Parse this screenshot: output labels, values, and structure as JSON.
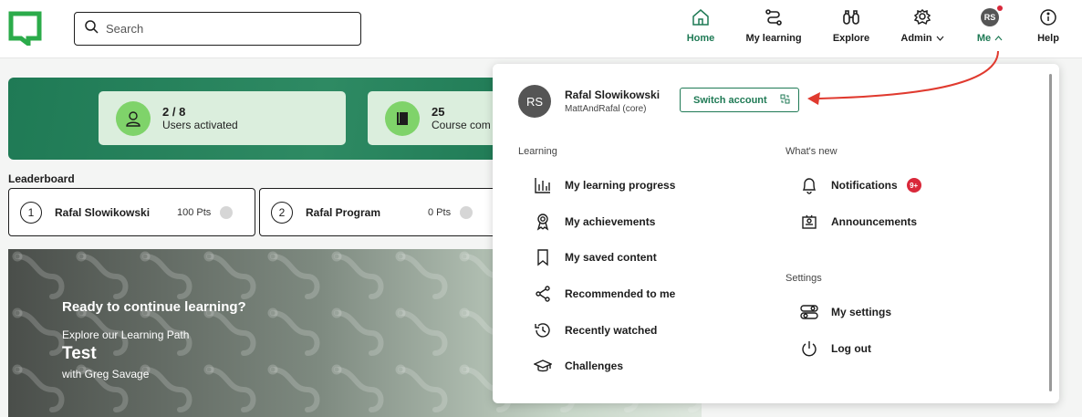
{
  "nav": {
    "search_placeholder": "Search",
    "items": [
      {
        "label": "Home",
        "icon": "home-icon"
      },
      {
        "label": "My learning",
        "icon": "learning-path-icon"
      },
      {
        "label": "Explore",
        "icon": "binoculars-icon"
      },
      {
        "label": "Admin",
        "icon": "admin-gear-icon"
      },
      {
        "label": "Me",
        "icon": "avatar"
      },
      {
        "label": "Help",
        "icon": "info-icon"
      }
    ],
    "avatar_initials": "RS",
    "accent_color": "#1f7a55"
  },
  "stats": [
    {
      "value": "2 / 8",
      "label": "Users activated",
      "icon": "user-icon"
    },
    {
      "value": "25",
      "label": "Course com",
      "icon": "book-icon"
    }
  ],
  "leaderboard": {
    "title": "Leaderboard",
    "entries": [
      {
        "rank": "1",
        "name": "Rafal Slowikowski",
        "points": "100 Pts"
      },
      {
        "rank": "2",
        "name": "Rafal Program",
        "points": "0 Pts"
      }
    ]
  },
  "hero": {
    "heading": "Ready to continue learning?",
    "subheading": "Explore our Learning Path",
    "path_title": "Test",
    "author": "with Greg Savage"
  },
  "menu": {
    "user_initials": "RS",
    "user_name": "Rafal Slowikowski",
    "user_org": "MattAndRafal (core)",
    "switch_label": "Switch account",
    "learning_title": "Learning",
    "learning_items": [
      {
        "label": "My learning progress",
        "icon": "bar-chart-icon"
      },
      {
        "label": "My achievements",
        "icon": "award-icon"
      },
      {
        "label": "My saved content",
        "icon": "bookmark-icon"
      },
      {
        "label": "Recommended to me",
        "icon": "share-icon"
      },
      {
        "label": "Recently watched",
        "icon": "history-icon"
      },
      {
        "label": "Challenges",
        "icon": "graduation-cap-icon"
      }
    ],
    "whatsnew_title": "What's new",
    "whatsnew_items": [
      {
        "label": "Notifications",
        "icon": "bell-icon",
        "badge": "9+"
      },
      {
        "label": "Announcements",
        "icon": "announcement-icon"
      }
    ],
    "settings_title": "Settings",
    "settings_items": [
      {
        "label": "My settings",
        "icon": "toggle-settings-icon"
      },
      {
        "label": "Log out",
        "icon": "power-icon"
      }
    ]
  },
  "annotation_color": "#e03a2f"
}
